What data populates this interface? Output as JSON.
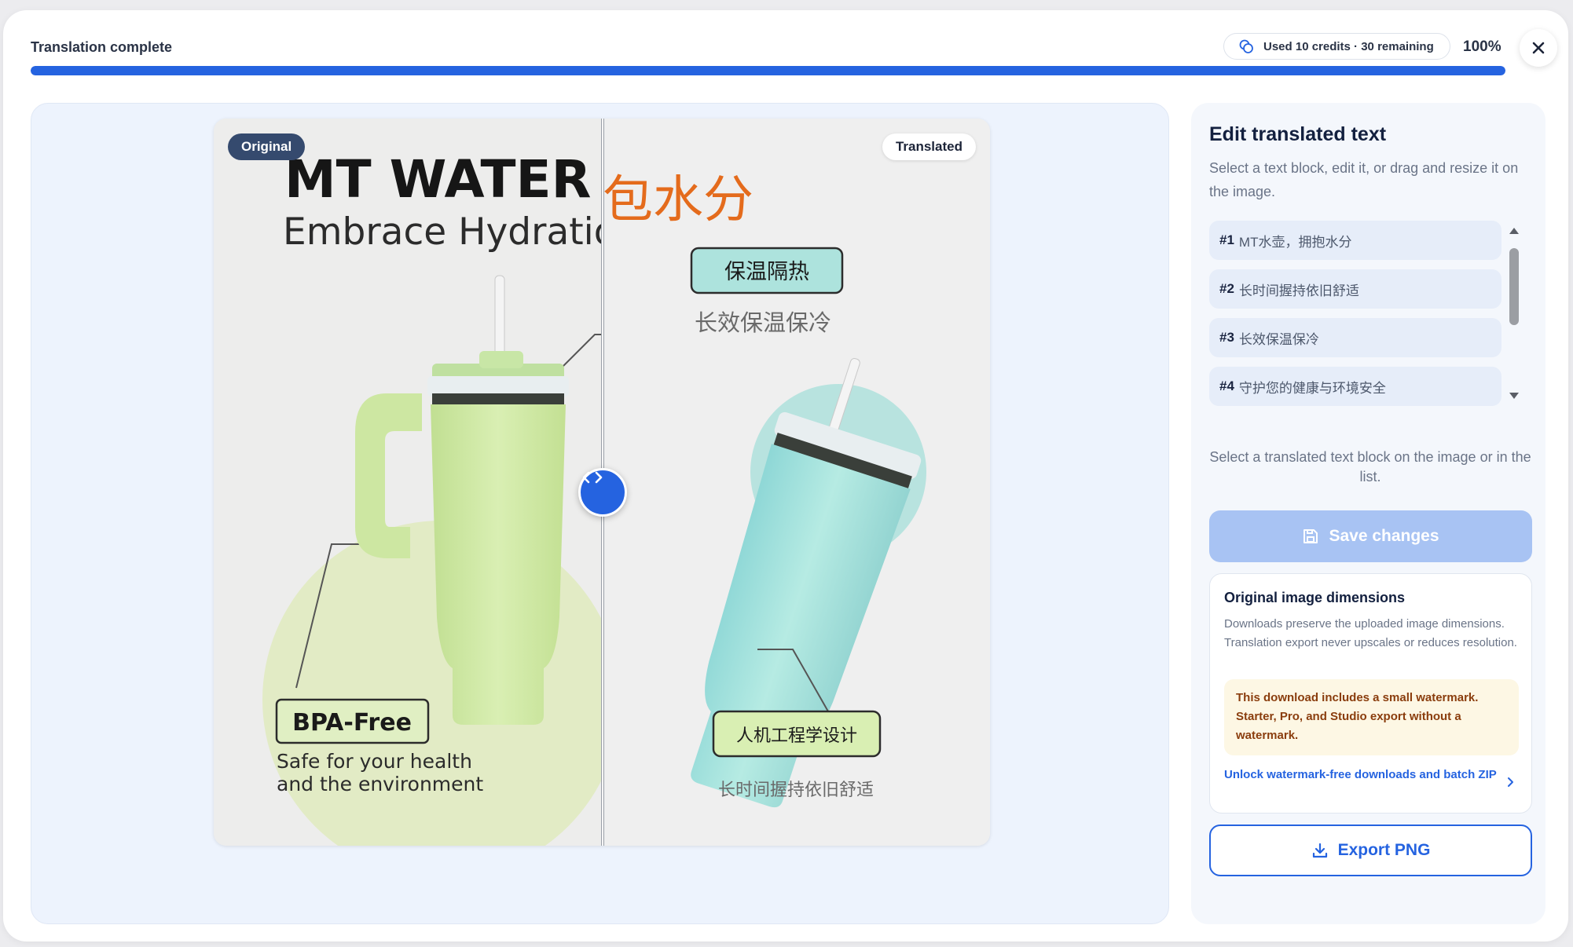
{
  "header": {
    "status": "Translation complete",
    "credits": "Used 10 credits · 30 remaining",
    "percent": "100%",
    "progress": 1.0
  },
  "compare": {
    "original_tag": "Original",
    "translated_tag": "Translated",
    "image": {
      "original_title": "MT WATER",
      "original_subtitle": "Embrace Hydratio",
      "original_bpa": "BPA-Free",
      "original_safe_1": "Safe for your health",
      "original_safe_2": "and the environment",
      "translated_title_fragment": "包水分",
      "translated_insulation": "保温隔热",
      "translated_keep_warm": "长效保温保冷",
      "translated_ergonomic": "人机工程学设计",
      "translated_comfort": "长时间握持依旧舒适"
    }
  },
  "panel": {
    "title": "Edit translated text",
    "subtitle": "Select a text block, edit it, or drag and resize it on the image.",
    "blocks": [
      {
        "num": "#1",
        "text": "MT水壶，拥抱水分"
      },
      {
        "num": "#2",
        "text": "长时间握持依旧舒适"
      },
      {
        "num": "#3",
        "text": "长效保温保冷"
      },
      {
        "num": "#4",
        "text": "守护您的健康与环境安全"
      }
    ],
    "hint": "Select a translated text block on the image or in the list.",
    "save_label": "Save changes",
    "dims_title": "Original image dimensions",
    "dims_desc": "Downloads preserve the uploaded image dimensions. Translation export never upscales or reduces resolution.",
    "watermark_note": "This download includes a small watermark. Starter, Pro, and Studio export without a watermark.",
    "unlock_label": "Unlock watermark-free downloads and batch ZIP",
    "export_label": "Export PNG"
  },
  "colors": {
    "accent": "#2563e0",
    "cup_green": "#d3ecaa",
    "cup_teal": "#a6e2dc",
    "orange": "#e46b1c"
  }
}
